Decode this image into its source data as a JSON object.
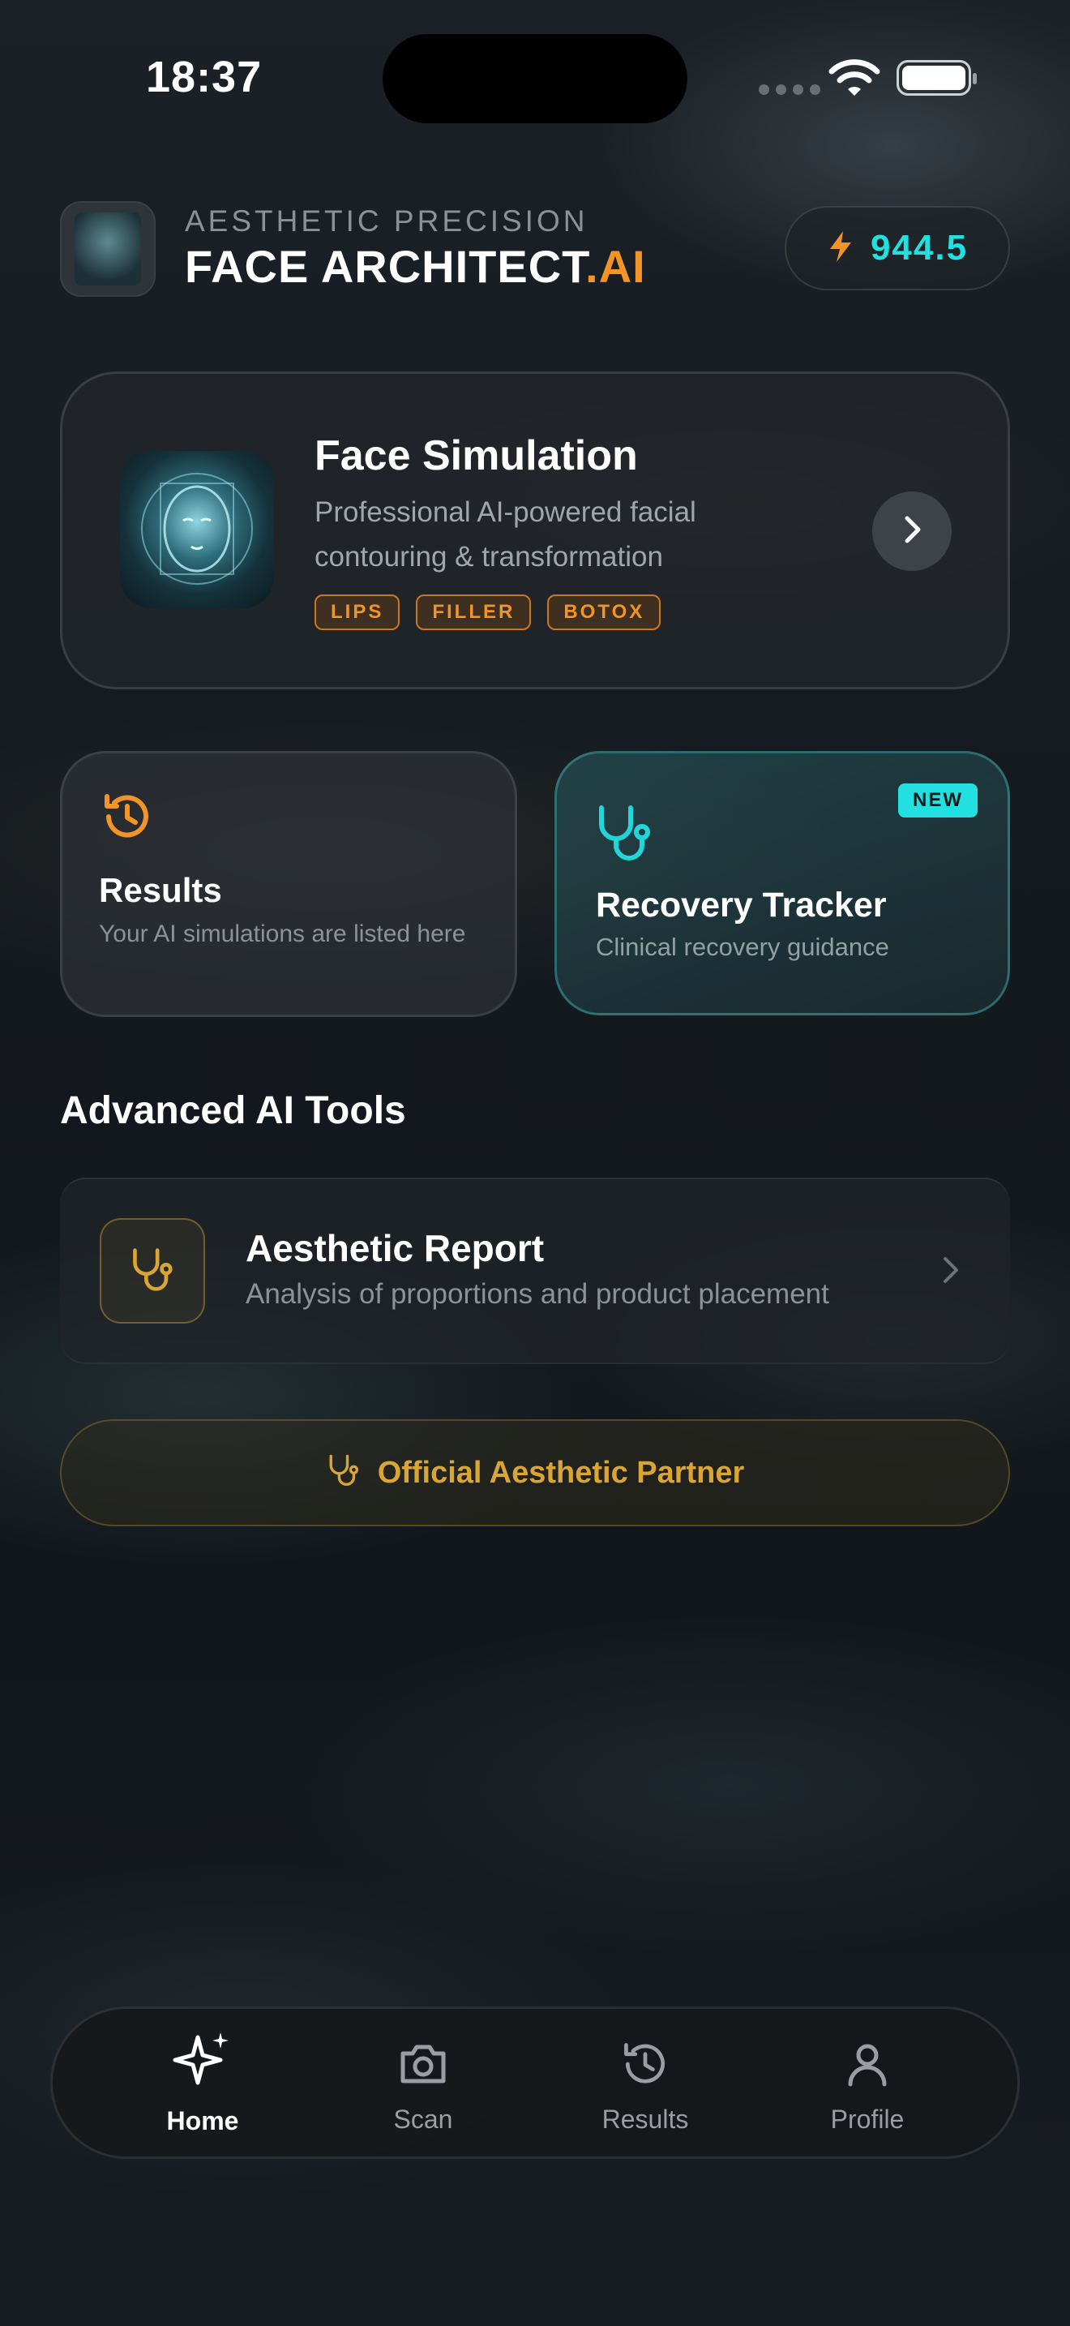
{
  "status_bar": {
    "time": "18:37"
  },
  "header": {
    "subtitle": "AESTHETIC PRECISION",
    "title_main": "FACE ARCHITECT",
    "title_accent": ".AI",
    "credits_value": "944.5",
    "credits_icon": "bolt-icon"
  },
  "face_simulation": {
    "title": "Face Simulation",
    "description": "Professional AI-powered facial contouring & transformation",
    "tags": [
      "LIPS",
      "FILLER",
      "BOTOX"
    ]
  },
  "results_card": {
    "title": "Results",
    "description": "Your AI simulations are listed here",
    "icon": "history-icon"
  },
  "recovery_card": {
    "badge": "NEW",
    "title": "Recovery Tracker",
    "description": "Clinical recovery guidance",
    "icon": "stethoscope-icon"
  },
  "advanced_tools": {
    "section_title": "Advanced AI Tools",
    "items": [
      {
        "title": "Aesthetic Report",
        "description": "Analysis of proportions and product placement",
        "icon": "stethoscope-icon"
      }
    ]
  },
  "partner": {
    "label": "Official Aesthetic Partner"
  },
  "tab_bar": {
    "items": [
      {
        "label": "Home",
        "icon": "sparkles-icon",
        "active": true
      },
      {
        "label": "Scan",
        "icon": "camera-icon",
        "active": false
      },
      {
        "label": "Results",
        "icon": "history-icon",
        "active": false
      },
      {
        "label": "Profile",
        "icon": "user-icon",
        "active": false
      }
    ]
  },
  "colors": {
    "accent_orange": "#f39426",
    "accent_cyan": "#22e0e0",
    "gold": "#d9a636"
  }
}
